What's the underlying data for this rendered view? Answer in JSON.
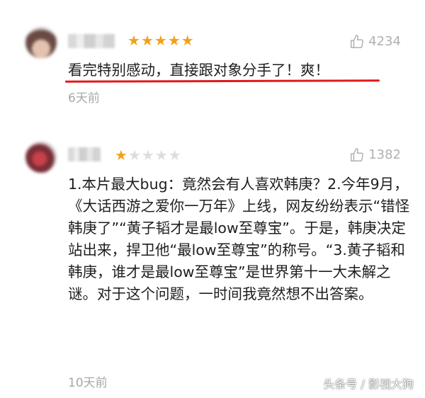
{
  "reviews": [
    {
      "rating": 5,
      "likes": "4234",
      "comment": "看完特别感动，直接跟对象分手了！爽！",
      "time": "6天前"
    },
    {
      "rating": 1,
      "likes": "1382",
      "comment": "1.本片最大bug：竟然会有人喜欢韩庚？2.今年9月，《大话西游之爱你一万年》上线，网友纷纷表示“错怪韩庚了”“黄子韬才是最low至尊宝”。于是，韩庚决定站出来，捍卫他“最low至尊宝”的称号。“3.黄子韬和韩庚，谁才是最low至尊宝”是世界第十一大未解之谜。对于这个问题，一时间我竟然想不出答案。",
      "time": "10天前"
    }
  ],
  "colors": {
    "star_on": "#f2a01b",
    "star_off": "#dddddd",
    "underline": "#e0191b",
    "meta_text": "#a8a8a8"
  },
  "icons": {
    "like": "thumbs-up-icon",
    "star": "star-icon"
  },
  "watermark": "头条号 / 影视大狗"
}
